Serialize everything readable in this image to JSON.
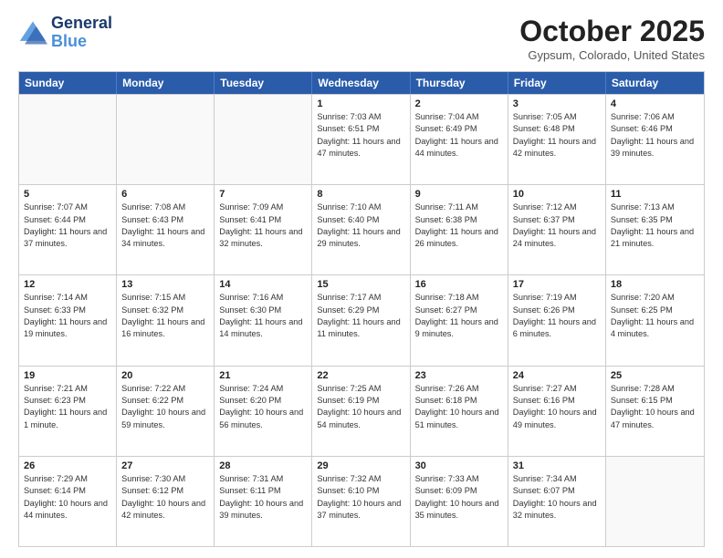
{
  "header": {
    "logo_line1": "General",
    "logo_line2": "Blue",
    "month": "October 2025",
    "location": "Gypsum, Colorado, United States"
  },
  "days_of_week": [
    "Sunday",
    "Monday",
    "Tuesday",
    "Wednesday",
    "Thursday",
    "Friday",
    "Saturday"
  ],
  "weeks": [
    [
      {
        "day": "",
        "info": ""
      },
      {
        "day": "",
        "info": ""
      },
      {
        "day": "",
        "info": ""
      },
      {
        "day": "1",
        "info": "Sunrise: 7:03 AM\nSunset: 6:51 PM\nDaylight: 11 hours and 47 minutes."
      },
      {
        "day": "2",
        "info": "Sunrise: 7:04 AM\nSunset: 6:49 PM\nDaylight: 11 hours and 44 minutes."
      },
      {
        "day": "3",
        "info": "Sunrise: 7:05 AM\nSunset: 6:48 PM\nDaylight: 11 hours and 42 minutes."
      },
      {
        "day": "4",
        "info": "Sunrise: 7:06 AM\nSunset: 6:46 PM\nDaylight: 11 hours and 39 minutes."
      }
    ],
    [
      {
        "day": "5",
        "info": "Sunrise: 7:07 AM\nSunset: 6:44 PM\nDaylight: 11 hours and 37 minutes."
      },
      {
        "day": "6",
        "info": "Sunrise: 7:08 AM\nSunset: 6:43 PM\nDaylight: 11 hours and 34 minutes."
      },
      {
        "day": "7",
        "info": "Sunrise: 7:09 AM\nSunset: 6:41 PM\nDaylight: 11 hours and 32 minutes."
      },
      {
        "day": "8",
        "info": "Sunrise: 7:10 AM\nSunset: 6:40 PM\nDaylight: 11 hours and 29 minutes."
      },
      {
        "day": "9",
        "info": "Sunrise: 7:11 AM\nSunset: 6:38 PM\nDaylight: 11 hours and 26 minutes."
      },
      {
        "day": "10",
        "info": "Sunrise: 7:12 AM\nSunset: 6:37 PM\nDaylight: 11 hours and 24 minutes."
      },
      {
        "day": "11",
        "info": "Sunrise: 7:13 AM\nSunset: 6:35 PM\nDaylight: 11 hours and 21 minutes."
      }
    ],
    [
      {
        "day": "12",
        "info": "Sunrise: 7:14 AM\nSunset: 6:33 PM\nDaylight: 11 hours and 19 minutes."
      },
      {
        "day": "13",
        "info": "Sunrise: 7:15 AM\nSunset: 6:32 PM\nDaylight: 11 hours and 16 minutes."
      },
      {
        "day": "14",
        "info": "Sunrise: 7:16 AM\nSunset: 6:30 PM\nDaylight: 11 hours and 14 minutes."
      },
      {
        "day": "15",
        "info": "Sunrise: 7:17 AM\nSunset: 6:29 PM\nDaylight: 11 hours and 11 minutes."
      },
      {
        "day": "16",
        "info": "Sunrise: 7:18 AM\nSunset: 6:27 PM\nDaylight: 11 hours and 9 minutes."
      },
      {
        "day": "17",
        "info": "Sunrise: 7:19 AM\nSunset: 6:26 PM\nDaylight: 11 hours and 6 minutes."
      },
      {
        "day": "18",
        "info": "Sunrise: 7:20 AM\nSunset: 6:25 PM\nDaylight: 11 hours and 4 minutes."
      }
    ],
    [
      {
        "day": "19",
        "info": "Sunrise: 7:21 AM\nSunset: 6:23 PM\nDaylight: 11 hours and 1 minute."
      },
      {
        "day": "20",
        "info": "Sunrise: 7:22 AM\nSunset: 6:22 PM\nDaylight: 10 hours and 59 minutes."
      },
      {
        "day": "21",
        "info": "Sunrise: 7:24 AM\nSunset: 6:20 PM\nDaylight: 10 hours and 56 minutes."
      },
      {
        "day": "22",
        "info": "Sunrise: 7:25 AM\nSunset: 6:19 PM\nDaylight: 10 hours and 54 minutes."
      },
      {
        "day": "23",
        "info": "Sunrise: 7:26 AM\nSunset: 6:18 PM\nDaylight: 10 hours and 51 minutes."
      },
      {
        "day": "24",
        "info": "Sunrise: 7:27 AM\nSunset: 6:16 PM\nDaylight: 10 hours and 49 minutes."
      },
      {
        "day": "25",
        "info": "Sunrise: 7:28 AM\nSunset: 6:15 PM\nDaylight: 10 hours and 47 minutes."
      }
    ],
    [
      {
        "day": "26",
        "info": "Sunrise: 7:29 AM\nSunset: 6:14 PM\nDaylight: 10 hours and 44 minutes."
      },
      {
        "day": "27",
        "info": "Sunrise: 7:30 AM\nSunset: 6:12 PM\nDaylight: 10 hours and 42 minutes."
      },
      {
        "day": "28",
        "info": "Sunrise: 7:31 AM\nSunset: 6:11 PM\nDaylight: 10 hours and 39 minutes."
      },
      {
        "day": "29",
        "info": "Sunrise: 7:32 AM\nSunset: 6:10 PM\nDaylight: 10 hours and 37 minutes."
      },
      {
        "day": "30",
        "info": "Sunrise: 7:33 AM\nSunset: 6:09 PM\nDaylight: 10 hours and 35 minutes."
      },
      {
        "day": "31",
        "info": "Sunrise: 7:34 AM\nSunset: 6:07 PM\nDaylight: 10 hours and 32 minutes."
      },
      {
        "day": "",
        "info": ""
      }
    ]
  ]
}
